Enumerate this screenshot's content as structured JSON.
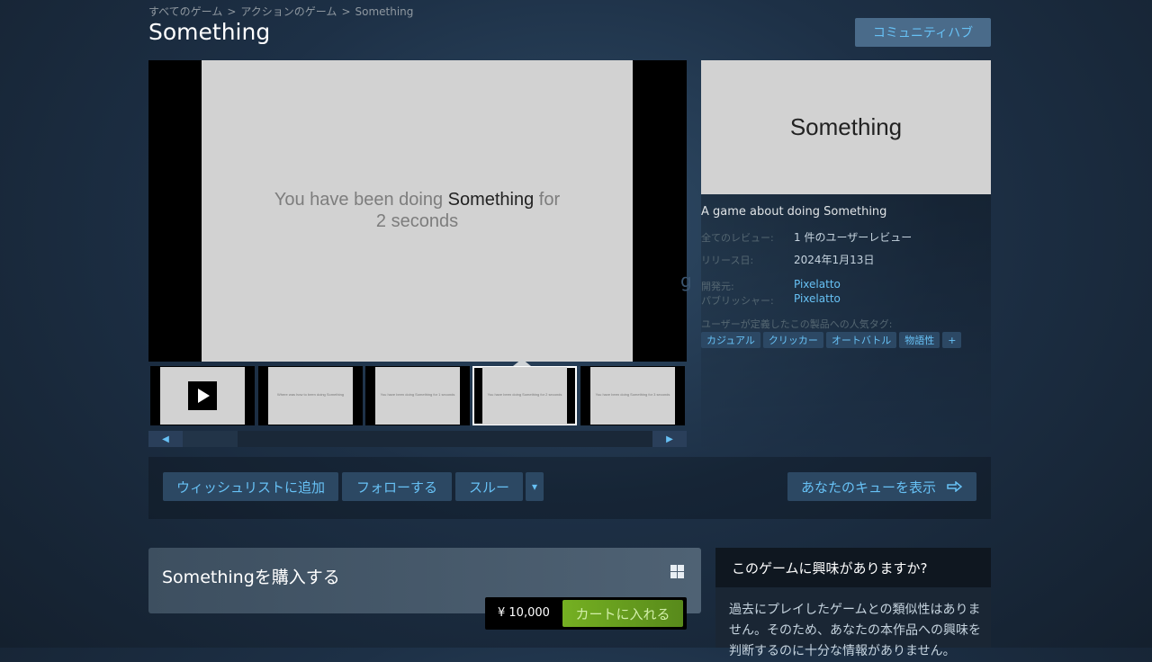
{
  "breadcrumb": {
    "items": [
      "すべてのゲーム",
      "アクションのゲーム",
      "Something"
    ],
    "separator": ">"
  },
  "page_title": "Something",
  "community_hub_label": "コミュニティハブ",
  "screenshot": {
    "text_before": "You have been doing ",
    "text_highlight": "Something",
    "text_after": " for",
    "text_line2": "2 seconds"
  },
  "thumbnails": [
    {
      "type": "video"
    },
    {
      "type": "image",
      "text": "Where was how to been doing Something"
    },
    {
      "type": "image",
      "text": "You have been doing Something for 1 seconds"
    },
    {
      "type": "image",
      "text": "You have been doing Something for 2 seconds",
      "selected": true
    },
    {
      "type": "image",
      "text": "You have been doing Something for 3 seconds"
    }
  ],
  "capsule_title": "Something",
  "description": "A game about doing Something",
  "details": {
    "reviews_label": "全てのレビュー:",
    "reviews_value": "1 件のユーザーレビュー",
    "release_label": "リリース日:",
    "release_value": "2024年1月13日",
    "developer_label": "開発元:",
    "developer_value": "Pixelatto",
    "publisher_label": "パブリッシャー:",
    "publisher_value": "Pixelatto"
  },
  "tags_label": "ユーザーが定義したこの製品への人気タグ:",
  "tags": [
    "カジュアル",
    "クリッカー",
    "オートバトル",
    "物語性",
    "+"
  ],
  "actions": {
    "wishlist": "ウィッシュリストに追加",
    "follow": "フォローする",
    "ignore": "スルー",
    "dropdown": "▾",
    "queue": "あなたのキューを表示"
  },
  "purchase": {
    "title": "Somethingを購入する",
    "price": "¥ 10,000",
    "cart_button": "カートに入れる"
  },
  "interest": {
    "heading": "このゲームに興味がありますか?",
    "body": "過去にプレイしたゲームとの類似性はありません。そのため、あなたの本作品への興味を判断するのに十分な情報がありません。"
  },
  "colors": {
    "accent": "#67c1f5",
    "cart_green": "#75b022",
    "background": "#1b2838"
  }
}
